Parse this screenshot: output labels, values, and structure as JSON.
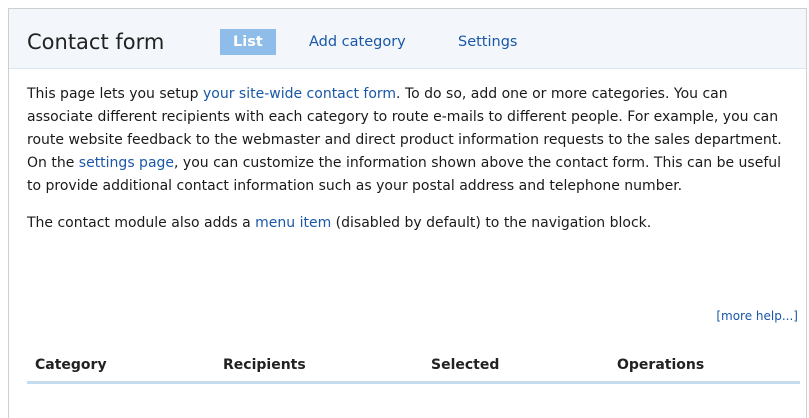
{
  "header": {
    "title": "Contact form",
    "tabs": [
      {
        "label": "List",
        "active": true
      },
      {
        "label": "Add category",
        "active": false
      },
      {
        "label": "Settings",
        "active": false
      }
    ]
  },
  "help": {
    "p1": {
      "t1": "This page lets you setup ",
      "link1": "your site-wide contact form",
      "t2": ". To do so, add one or more categories. You can associate different recipients with each category to route e-mails to different people. For example, you can route website feedback to the webmaster and direct product information requests to the sales department. On the ",
      "link2": "settings page",
      "t3": ", you can customize the information shown above the contact form. This can be useful to provide additional contact information such as your postal address and telephone number."
    },
    "p2": {
      "t1": "The contact module also adds a ",
      "link": "menu item",
      "t2": " (disabled by default) to the navigation block."
    },
    "more_help": "[more help...]"
  },
  "table": {
    "columns": [
      "Category",
      "Recipients",
      "Selected",
      "Operations"
    ]
  },
  "colors": {
    "link": "#1a57a8",
    "active_tab_bg": "#8ebdea",
    "header_bg": "#f3f7fb",
    "table_rule": "#c5dcee"
  }
}
